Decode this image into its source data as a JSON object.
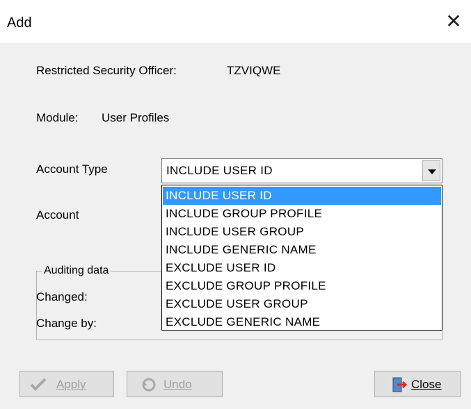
{
  "window": {
    "title": "Add",
    "close_glyph": "✕"
  },
  "info": {
    "officer_label": "Restricted Security Officer:",
    "officer_value": "TZVIQWE",
    "module_label": "Module:",
    "module_value": "User Profiles"
  },
  "form": {
    "account_type_label": "Account Type",
    "account_type_value": "INCLUDE USER ID",
    "account_label": "Account",
    "account_value": ""
  },
  "dropdown": {
    "items": [
      "INCLUDE USER ID",
      "INCLUDE GROUP PROFILE",
      "INCLUDE USER GROUP",
      "INCLUDE GENERIC NAME",
      "EXCLUDE USER ID",
      "EXCLUDE GROUP PROFILE",
      "EXCLUDE USER GROUP",
      "EXCLUDE GENERIC NAME"
    ],
    "selected": "INCLUDE USER ID"
  },
  "auditing": {
    "title": "Auditing data",
    "changed_label": "Changed:",
    "change_by_label": "Change by:"
  },
  "buttons": {
    "apply": {
      "label": "Apply",
      "icon": "checkmark-icon",
      "enabled": false
    },
    "undo": {
      "label": "Undo",
      "icon": "undo-icon",
      "enabled": false
    },
    "close": {
      "label": "Close",
      "icon": "exit-door-icon",
      "enabled": true
    }
  },
  "colors": {
    "selection": "#3399ff",
    "dialog_bg": "#f0f0f0"
  }
}
